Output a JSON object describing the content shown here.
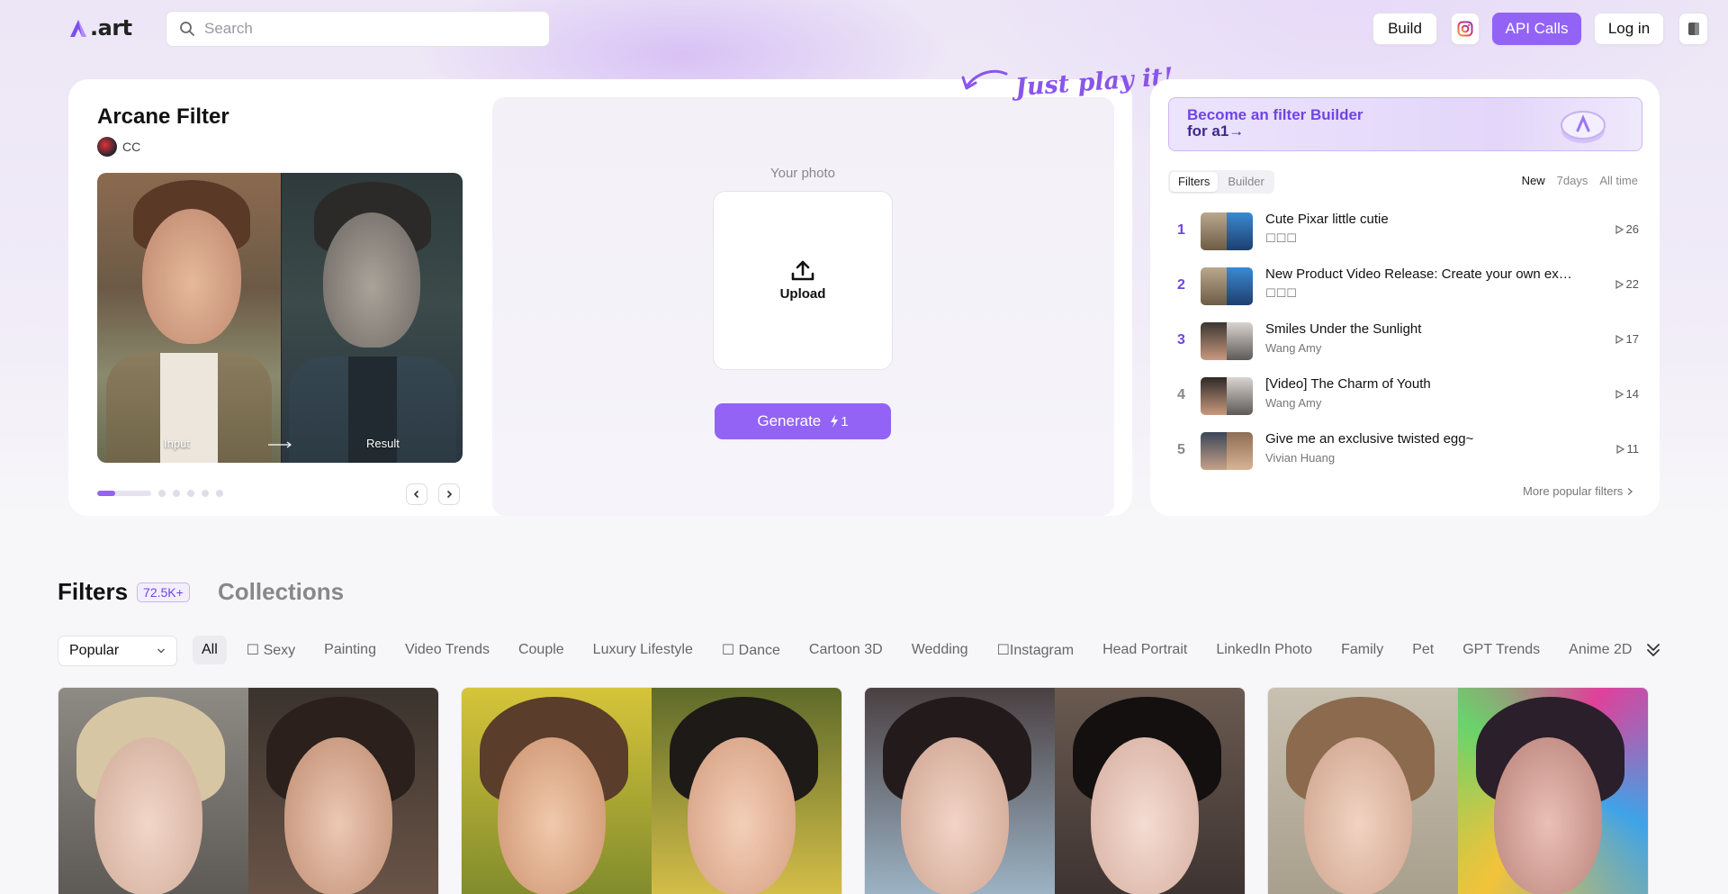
{
  "header": {
    "logo_text": ".art",
    "search_placeholder": "Search",
    "build_label": "Build",
    "api_label": "API Calls",
    "login_label": "Log in"
  },
  "hero": {
    "filter_title": "Arcane Filter",
    "author": "CC",
    "compare_input_label": "Input",
    "compare_result_label": "Result",
    "carousel_total": 6,
    "carousel_active": 1,
    "play_note": "Just play it!",
    "your_photo_label": "Your photo",
    "upload_label": "Upload",
    "generate_label": "Generate",
    "generate_cost": "1"
  },
  "ranking": {
    "banner_line1": "Become an filter Builder",
    "banner_line2": "for a1→",
    "segment_tabs": [
      "Filters",
      "Builder"
    ],
    "active_segment": "Filters",
    "time_tabs": [
      "New",
      "7days",
      "All time"
    ],
    "active_time": "New",
    "items": [
      {
        "rank": "1",
        "title": "Cute Pixar little cutie",
        "sub": "☐☐☐",
        "plays": "26",
        "rank_color": "#6f45e3"
      },
      {
        "rank": "2",
        "title": "New Product Video Release: Create your own exclusive video",
        "sub": "☐☐☐",
        "plays": "22",
        "rank_color": "#6f45e3"
      },
      {
        "rank": "3",
        "title": "Smiles Under the Sunlight",
        "sub": "Wang Amy",
        "plays": "17",
        "rank_color": "#6f45e3"
      },
      {
        "rank": "4",
        "title": "[Video] The Charm of Youth",
        "sub": "Wang Amy",
        "plays": "14",
        "rank_color": "#888888"
      },
      {
        "rank": "5",
        "title": "Give me an exclusive twisted egg~",
        "sub": "Vivian Huang",
        "plays": "11",
        "rank_color": "#888888"
      }
    ],
    "more_label": "More popular filters"
  },
  "filters": {
    "title": "Filters",
    "count": "72.5K+",
    "collections_label": "Collections",
    "sort_value": "Popular",
    "categories": [
      "All",
      "☐ Sexy",
      "Painting",
      "Video Trends",
      "Couple",
      "Luxury Lifestyle",
      "☐ Dance",
      "Cartoon 3D",
      "Wedding",
      "☐Instagram",
      "Head Portrait",
      "LinkedIn Photo",
      "Family",
      "Pet",
      "GPT Trends",
      "Anime 2D"
    ],
    "active_category": "All"
  },
  "colors": {
    "accent": "#9263f5",
    "accent_dark": "#6f45e3",
    "banner_text": "#3e2a8a"
  },
  "icons": {
    "search": "search-icon",
    "instagram": "instagram-icon",
    "menu_square": "square-icon",
    "upload": "upload-icon",
    "play": "play-icon",
    "chevron": "chevron-icon"
  }
}
